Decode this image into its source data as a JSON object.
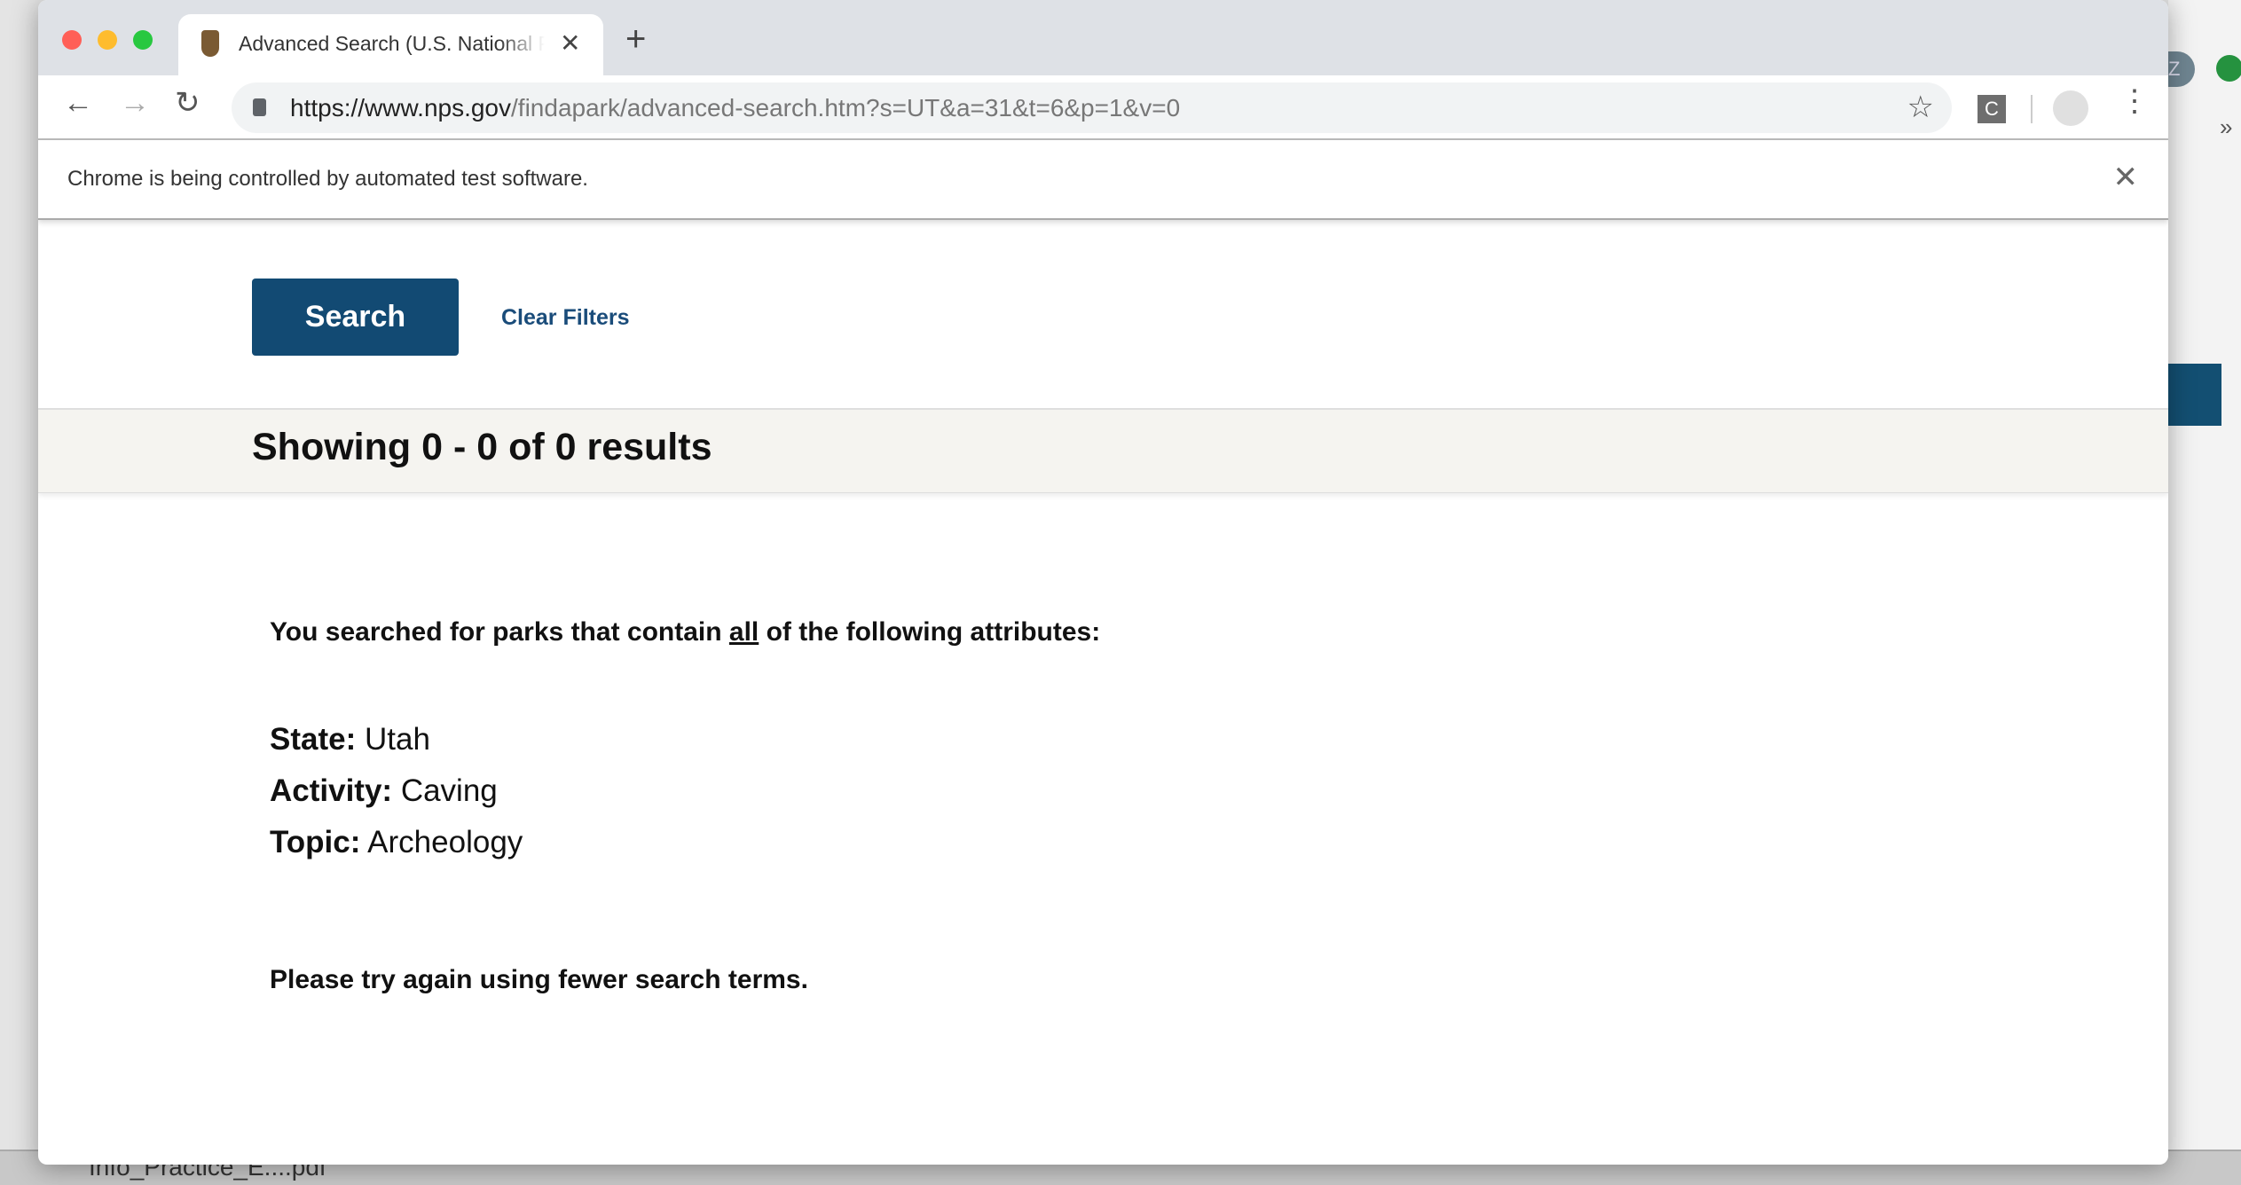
{
  "browser": {
    "tab_title": "Advanced Search (U.S. National Park Service)",
    "url_host": "https://www.nps.gov",
    "url_path": "/findapark/advanced-search.htm?s=UT&a=31&t=6&p=1&v=0",
    "extension_label": "C",
    "infobar_message": "Chrome is being controlled by automated test software.",
    "traffic_colors": [
      "#ff5f57",
      "#febc2e",
      "#28c840"
    ]
  },
  "background": {
    "avatar_letter": "Z",
    "download_file": "Info_Practice_E....pdf"
  },
  "page": {
    "search_button": "Search",
    "clear_filters": "Clear Filters",
    "results_heading": "Showing 0 - 0 of 0 results",
    "query_prefix": "You searched for parks that contain ",
    "query_emph": "all",
    "query_suffix": " of the following attributes:",
    "attributes": [
      {
        "label": "State:",
        "value": " Utah"
      },
      {
        "label": "Activity:",
        "value": " Caving"
      },
      {
        "label": "Topic:",
        "value": " Archeology"
      }
    ],
    "hint": "Please try again using fewer search terms.",
    "accent_color": "#124a73"
  }
}
